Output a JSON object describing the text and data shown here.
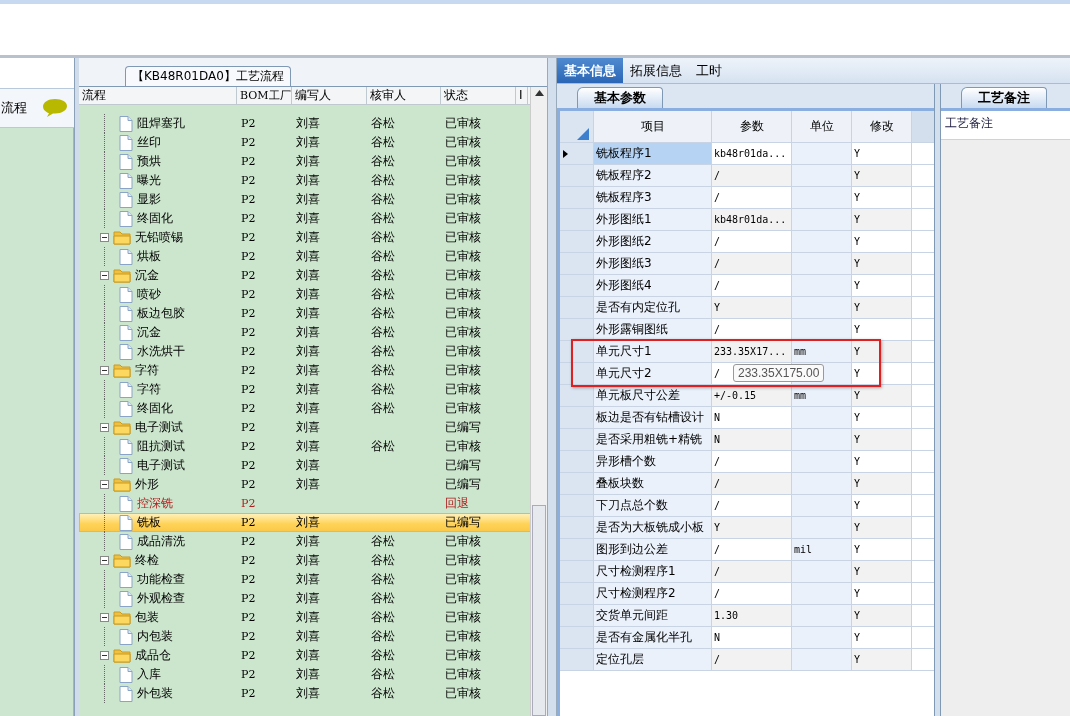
{
  "left_panel": {
    "title": "流程"
  },
  "flow_tab": {
    "label": "【KB48R01DA0】工艺流程"
  },
  "tree_grid": {
    "columns": [
      "流程",
      "BOM工厂",
      "编写人",
      "核审人",
      "状态",
      "I"
    ],
    "leading_rows": [
      {
        "name": "阻焊塞孔",
        "factory": "P2",
        "writer": "刘喜",
        "reviewer": "谷松",
        "status": "已审核",
        "returned": false,
        "selected": false
      },
      {
        "name": "丝印",
        "factory": "P2",
        "writer": "刘喜",
        "reviewer": "谷松",
        "status": "已审核",
        "returned": false,
        "selected": false
      },
      {
        "name": "预烘",
        "factory": "P2",
        "writer": "刘喜",
        "reviewer": "谷松",
        "status": "已审核",
        "returned": false,
        "selected": false
      },
      {
        "name": "曝光",
        "factory": "P2",
        "writer": "刘喜",
        "reviewer": "谷松",
        "status": "已审核",
        "returned": false,
        "selected": false
      },
      {
        "name": "显影",
        "factory": "P2",
        "writer": "刘喜",
        "reviewer": "谷松",
        "status": "已审核",
        "returned": false,
        "selected": false
      },
      {
        "name": "终固化",
        "factory": "P2",
        "writer": "刘喜",
        "reviewer": "谷松",
        "status": "已审核",
        "returned": false,
        "selected": false
      }
    ],
    "groups": [
      {
        "name": "无铅喷锡",
        "factory": "P2",
        "writer": "刘喜",
        "reviewer": "谷松",
        "status": "已审核",
        "expanded": true,
        "children": [
          {
            "name": "烘板",
            "factory": "P2",
            "writer": "刘喜",
            "reviewer": "谷松",
            "status": "已审核",
            "returned": false,
            "selected": false
          }
        ]
      },
      {
        "name": "沉金",
        "factory": "P2",
        "writer": "刘喜",
        "reviewer": "谷松",
        "status": "已审核",
        "expanded": true,
        "children": [
          {
            "name": "喷砂",
            "factory": "P2",
            "writer": "刘喜",
            "reviewer": "谷松",
            "status": "已审核",
            "returned": false,
            "selected": false
          },
          {
            "name": "板边包胶",
            "factory": "P2",
            "writer": "刘喜",
            "reviewer": "谷松",
            "status": "已审核",
            "returned": false,
            "selected": false
          },
          {
            "name": "沉金",
            "factory": "P2",
            "writer": "刘喜",
            "reviewer": "谷松",
            "status": "已审核",
            "returned": false,
            "selected": false
          },
          {
            "name": "水洗烘干",
            "factory": "P2",
            "writer": "刘喜",
            "reviewer": "谷松",
            "status": "已审核",
            "returned": false,
            "selected": false
          }
        ]
      },
      {
        "name": "字符",
        "factory": "P2",
        "writer": "刘喜",
        "reviewer": "谷松",
        "status": "已审核",
        "expanded": true,
        "children": [
          {
            "name": "字符",
            "factory": "P2",
            "writer": "刘喜",
            "reviewer": "谷松",
            "status": "已审核",
            "returned": false,
            "selected": false
          },
          {
            "name": "终固化",
            "factory": "P2",
            "writer": "刘喜",
            "reviewer": "谷松",
            "status": "已审核",
            "returned": false,
            "selected": false
          }
        ]
      },
      {
        "name": "电子测试",
        "factory": "P2",
        "writer": "刘喜",
        "status": "已编写",
        "expanded": true,
        "children": [
          {
            "name": "阻抗测试",
            "factory": "P2",
            "writer": "刘喜",
            "reviewer": "谷松",
            "status": "已审核",
            "returned": false,
            "selected": false
          },
          {
            "name": "电子测试",
            "factory": "P2",
            "writer": "刘喜",
            "status": "已编写",
            "returned": false,
            "selected": false
          }
        ]
      },
      {
        "name": "外形",
        "factory": "P2",
        "writer": "刘喜",
        "status": "已编写",
        "expanded": true,
        "children": [
          {
            "name": "控深铣",
            "factory": "P2",
            "status": "回退",
            "returned": true,
            "selected": false
          },
          {
            "name": "铣板",
            "factory": "P2",
            "writer": "刘喜",
            "status": "已编写",
            "returned": false,
            "selected": true
          },
          {
            "name": "成品清洗",
            "factory": "P2",
            "writer": "刘喜",
            "reviewer": "谷松",
            "status": "已审核",
            "returned": false,
            "selected": false
          }
        ]
      },
      {
        "name": "终检",
        "factory": "P2",
        "writer": "刘喜",
        "reviewer": "谷松",
        "status": "已审核",
        "expanded": true,
        "children": [
          {
            "name": "功能检查",
            "factory": "P2",
            "writer": "刘喜",
            "reviewer": "谷松",
            "status": "已审核",
            "returned": false,
            "selected": false
          },
          {
            "name": "外观检查",
            "factory": "P2",
            "writer": "刘喜",
            "reviewer": "谷松",
            "status": "已审核",
            "returned": false,
            "selected": false
          }
        ]
      },
      {
        "name": "包装",
        "factory": "P2",
        "writer": "刘喜",
        "reviewer": "谷松",
        "status": "已审核",
        "expanded": true,
        "children": [
          {
            "name": "内包装",
            "factory": "P2",
            "writer": "刘喜",
            "reviewer": "谷松",
            "status": "已审核",
            "returned": false,
            "selected": false
          }
        ]
      },
      {
        "name": "成品仓",
        "factory": "P2",
        "writer": "刘喜",
        "reviewer": "谷松",
        "status": "已审核",
        "expanded": true,
        "children": [
          {
            "name": "入库",
            "factory": "P2",
            "writer": "刘喜",
            "reviewer": "谷松",
            "status": "已审核",
            "returned": false,
            "selected": false
          },
          {
            "name": "外包装",
            "factory": "P2",
            "writer": "刘喜",
            "reviewer": "谷松",
            "status": "已审核",
            "returned": false,
            "selected": false
          }
        ]
      }
    ]
  },
  "tabs": [
    {
      "label": "基本信息",
      "selected": true
    },
    {
      "label": "拓展信息",
      "selected": false
    },
    {
      "label": "工时",
      "selected": false
    }
  ],
  "params": {
    "tab": "基本参数",
    "columns": [
      "项目",
      "参数",
      "单位",
      "修改"
    ],
    "rows": [
      {
        "item": "铣板程序1",
        "param": "kb48r01da...",
        "modify": "Y",
        "selected": true
      },
      {
        "item": "铣板程序2",
        "param": "/",
        "modify": "Y",
        "selected": false
      },
      {
        "item": "铣板程序3",
        "param": "/",
        "modify": "Y",
        "selected": false
      },
      {
        "item": "外形图纸1",
        "param": "kb48r01da...",
        "modify": "Y",
        "selected": false
      },
      {
        "item": "外形图纸2",
        "param": "/",
        "modify": "Y",
        "selected": false
      },
      {
        "item": "外形图纸3",
        "param": "/",
        "modify": "Y",
        "selected": false
      },
      {
        "item": "外形图纸4",
        "param": "/",
        "modify": "Y",
        "selected": false
      },
      {
        "item": "是否有内定位孔",
        "param": "Y",
        "modify": "Y",
        "selected": false
      },
      {
        "item": "外形露铜图纸",
        "param": "/",
        "modify": "Y",
        "selected": false
      },
      {
        "item": "单元尺寸1",
        "param": "233.35X17...",
        "unit": "mm",
        "modify": "Y",
        "selected": false
      },
      {
        "item": "单元尺寸2",
        "param": "/",
        "modify": "Y",
        "selected": false
      },
      {
        "item": "单元板尺寸公差",
        "param": "+/-0.15",
        "unit": "mm",
        "modify": "Y",
        "selected": false
      },
      {
        "item": "板边是否有钻槽设计",
        "param": "N",
        "modify": "Y",
        "selected": false
      },
      {
        "item": "是否采用粗铣+精铣",
        "param": "N",
        "modify": "Y",
        "selected": false
      },
      {
        "item": "异形槽个数",
        "param": "/",
        "modify": "Y",
        "selected": false
      },
      {
        "item": "叠板块数",
        "param": "/",
        "modify": "Y",
        "selected": false
      },
      {
        "item": "下刀点总个数",
        "param": "/",
        "modify": "Y",
        "selected": false
      },
      {
        "item": "是否为大板铣成小板",
        "param": "Y",
        "modify": "Y",
        "selected": false
      },
      {
        "item": "图形到边公差",
        "param": "/",
        "unit": "mil",
        "modify": "Y",
        "selected": false
      },
      {
        "item": "尺寸检测程序1",
        "param": "/",
        "modify": "Y",
        "selected": false
      },
      {
        "item": "尺寸检测程序2",
        "param": "/",
        "modify": "Y",
        "selected": false
      },
      {
        "item": "交货单元间距",
        "param": "1.30",
        "modify": "Y",
        "selected": false
      },
      {
        "item": "是否有金属化半孔",
        "param": "N",
        "modify": "Y",
        "selected": false
      },
      {
        "item": "定位孔层",
        "param": "/",
        "modify": "Y",
        "selected": false
      }
    ],
    "tooltip": "233.35X175.00"
  },
  "notes": {
    "tab": "工艺备注",
    "label": "工艺备注"
  }
}
